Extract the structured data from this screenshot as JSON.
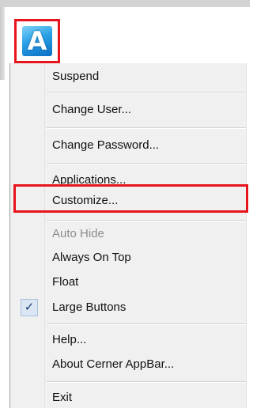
{
  "appbar": {
    "icon_letter": "A",
    "icon_name": "cerner-appbar-icon"
  },
  "menu": {
    "items": [
      {
        "label": "Suspend"
      },
      {
        "label": "Change User..."
      },
      {
        "label": "Change Password..."
      },
      {
        "label": "Applications..."
      },
      {
        "label": "Customize..."
      },
      {
        "label": "Auto Hide",
        "disabled": true
      },
      {
        "label": "Always On Top"
      },
      {
        "label": "Float"
      },
      {
        "label": "Large Buttons",
        "checked": true
      },
      {
        "label": "Help..."
      },
      {
        "label": "About Cerner AppBar..."
      },
      {
        "label": "Exit"
      }
    ],
    "check_glyph": "✓"
  },
  "colors": {
    "highlight": "#e8141b",
    "menu_background": "#f0f0f0",
    "disabled_text": "#8d8d8d"
  }
}
